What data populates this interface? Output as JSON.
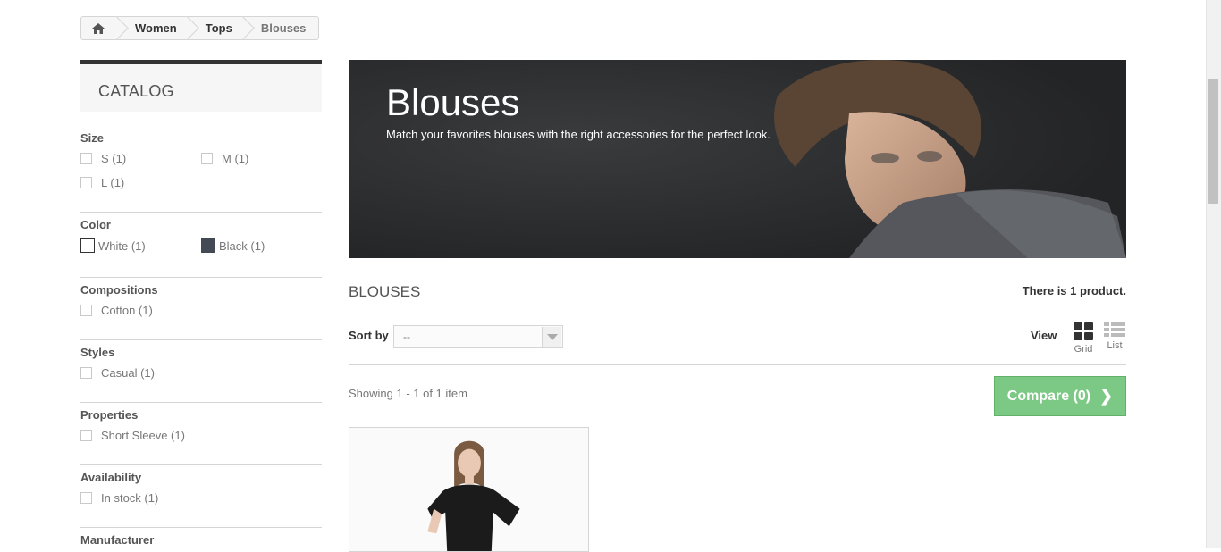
{
  "breadcrumb": {
    "home_icon": "home-icon",
    "items": [
      "Women",
      "Tops"
    ],
    "current": "Blouses"
  },
  "catalog": {
    "title": "CATALOG",
    "filters": {
      "size": {
        "label": "Size",
        "options": [
          "S (1)",
          "M (1)",
          "L (1)"
        ]
      },
      "color": {
        "label": "Color",
        "options": [
          {
            "label": "White (1)",
            "color": "#ffffff"
          },
          {
            "label": "Black (1)",
            "color": "#434a54"
          }
        ]
      },
      "compositions": {
        "label": "Compositions",
        "options": [
          "Cotton (1)"
        ]
      },
      "styles": {
        "label": "Styles",
        "options": [
          "Casual (1)"
        ]
      },
      "properties": {
        "label": "Properties",
        "options": [
          "Short Sleeve (1)"
        ]
      },
      "availability": {
        "label": "Availability",
        "options": [
          "In stock (1)"
        ]
      },
      "manufacturer": {
        "label": "Manufacturer"
      }
    }
  },
  "banner": {
    "title": "Blouses",
    "description": "Match your favorites blouses with the right accessories for the perfect look."
  },
  "listing": {
    "category_name": "BLOUSES",
    "count_text": "There is 1 product.",
    "sort_label": "Sort by",
    "sort_value": "--",
    "view_label": "View",
    "view_grid": "Grid",
    "view_list": "List",
    "showing": "Showing 1 - 1 of 1 item",
    "compare_label": "Compare (0)"
  },
  "colors": {
    "accent_green": "#76c67f",
    "dark": "#333333"
  }
}
